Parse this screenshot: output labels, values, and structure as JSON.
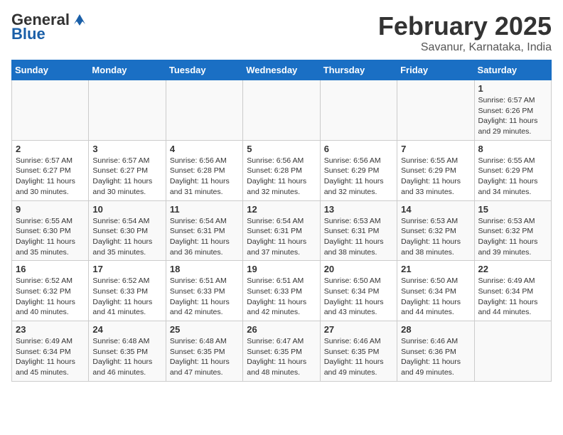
{
  "header": {
    "logo_line1": "General",
    "logo_line2": "Blue",
    "month": "February 2025",
    "location": "Savanur, Karnataka, India"
  },
  "weekdays": [
    "Sunday",
    "Monday",
    "Tuesday",
    "Wednesday",
    "Thursday",
    "Friday",
    "Saturday"
  ],
  "weeks": [
    [
      {
        "day": "",
        "info": ""
      },
      {
        "day": "",
        "info": ""
      },
      {
        "day": "",
        "info": ""
      },
      {
        "day": "",
        "info": ""
      },
      {
        "day": "",
        "info": ""
      },
      {
        "day": "",
        "info": ""
      },
      {
        "day": "1",
        "info": "Sunrise: 6:57 AM\nSunset: 6:26 PM\nDaylight: 11 hours and 29 minutes."
      }
    ],
    [
      {
        "day": "2",
        "info": "Sunrise: 6:57 AM\nSunset: 6:27 PM\nDaylight: 11 hours and 30 minutes."
      },
      {
        "day": "3",
        "info": "Sunrise: 6:57 AM\nSunset: 6:27 PM\nDaylight: 11 hours and 30 minutes."
      },
      {
        "day": "4",
        "info": "Sunrise: 6:56 AM\nSunset: 6:28 PM\nDaylight: 11 hours and 31 minutes."
      },
      {
        "day": "5",
        "info": "Sunrise: 6:56 AM\nSunset: 6:28 PM\nDaylight: 11 hours and 32 minutes."
      },
      {
        "day": "6",
        "info": "Sunrise: 6:56 AM\nSunset: 6:29 PM\nDaylight: 11 hours and 32 minutes."
      },
      {
        "day": "7",
        "info": "Sunrise: 6:55 AM\nSunset: 6:29 PM\nDaylight: 11 hours and 33 minutes."
      },
      {
        "day": "8",
        "info": "Sunrise: 6:55 AM\nSunset: 6:29 PM\nDaylight: 11 hours and 34 minutes."
      }
    ],
    [
      {
        "day": "9",
        "info": "Sunrise: 6:55 AM\nSunset: 6:30 PM\nDaylight: 11 hours and 35 minutes."
      },
      {
        "day": "10",
        "info": "Sunrise: 6:54 AM\nSunset: 6:30 PM\nDaylight: 11 hours and 35 minutes."
      },
      {
        "day": "11",
        "info": "Sunrise: 6:54 AM\nSunset: 6:31 PM\nDaylight: 11 hours and 36 minutes."
      },
      {
        "day": "12",
        "info": "Sunrise: 6:54 AM\nSunset: 6:31 PM\nDaylight: 11 hours and 37 minutes."
      },
      {
        "day": "13",
        "info": "Sunrise: 6:53 AM\nSunset: 6:31 PM\nDaylight: 11 hours and 38 minutes."
      },
      {
        "day": "14",
        "info": "Sunrise: 6:53 AM\nSunset: 6:32 PM\nDaylight: 11 hours and 38 minutes."
      },
      {
        "day": "15",
        "info": "Sunrise: 6:53 AM\nSunset: 6:32 PM\nDaylight: 11 hours and 39 minutes."
      }
    ],
    [
      {
        "day": "16",
        "info": "Sunrise: 6:52 AM\nSunset: 6:32 PM\nDaylight: 11 hours and 40 minutes."
      },
      {
        "day": "17",
        "info": "Sunrise: 6:52 AM\nSunset: 6:33 PM\nDaylight: 11 hours and 41 minutes."
      },
      {
        "day": "18",
        "info": "Sunrise: 6:51 AM\nSunset: 6:33 PM\nDaylight: 11 hours and 42 minutes."
      },
      {
        "day": "19",
        "info": "Sunrise: 6:51 AM\nSunset: 6:33 PM\nDaylight: 11 hours and 42 minutes."
      },
      {
        "day": "20",
        "info": "Sunrise: 6:50 AM\nSunset: 6:34 PM\nDaylight: 11 hours and 43 minutes."
      },
      {
        "day": "21",
        "info": "Sunrise: 6:50 AM\nSunset: 6:34 PM\nDaylight: 11 hours and 44 minutes."
      },
      {
        "day": "22",
        "info": "Sunrise: 6:49 AM\nSunset: 6:34 PM\nDaylight: 11 hours and 44 minutes."
      }
    ],
    [
      {
        "day": "23",
        "info": "Sunrise: 6:49 AM\nSunset: 6:34 PM\nDaylight: 11 hours and 45 minutes."
      },
      {
        "day": "24",
        "info": "Sunrise: 6:48 AM\nSunset: 6:35 PM\nDaylight: 11 hours and 46 minutes."
      },
      {
        "day": "25",
        "info": "Sunrise: 6:48 AM\nSunset: 6:35 PM\nDaylight: 11 hours and 47 minutes."
      },
      {
        "day": "26",
        "info": "Sunrise: 6:47 AM\nSunset: 6:35 PM\nDaylight: 11 hours and 48 minutes."
      },
      {
        "day": "27",
        "info": "Sunrise: 6:46 AM\nSunset: 6:35 PM\nDaylight: 11 hours and 49 minutes."
      },
      {
        "day": "28",
        "info": "Sunrise: 6:46 AM\nSunset: 6:36 PM\nDaylight: 11 hours and 49 minutes."
      },
      {
        "day": "",
        "info": ""
      }
    ]
  ]
}
